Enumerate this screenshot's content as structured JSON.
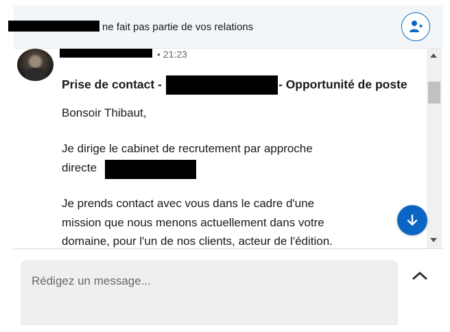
{
  "banner": {
    "text": "ne fait pas partie de vos relations",
    "add_icon": "person-add-icon"
  },
  "message": {
    "time": "• 21:23",
    "subject_prefix": "Prise de contact -",
    "subject_suffix": "- Opportunité de poste",
    "lines": [
      "Bonsoir Thibaut,",
      "Je dirige le cabinet de recrutement par approche",
      "directe",
      "Je prends contact avec vous dans le cadre d'une",
      "mission que nous menons actuellement dans votre",
      "domaine, pour l'un de nos clients, acteur de l'édition."
    ]
  },
  "composer": {
    "placeholder": "Rédigez un message..."
  },
  "icons": {
    "scroll_up": "scroll-up-arrow-icon",
    "scroll_down": "scroll-down-arrow-icon",
    "jump": "arrow-down-icon",
    "expand": "chevron-up-icon"
  },
  "colors": {
    "accent": "#0a66c2",
    "banner_bg": "#f3f6f8",
    "composer_bg": "#f0efed"
  }
}
